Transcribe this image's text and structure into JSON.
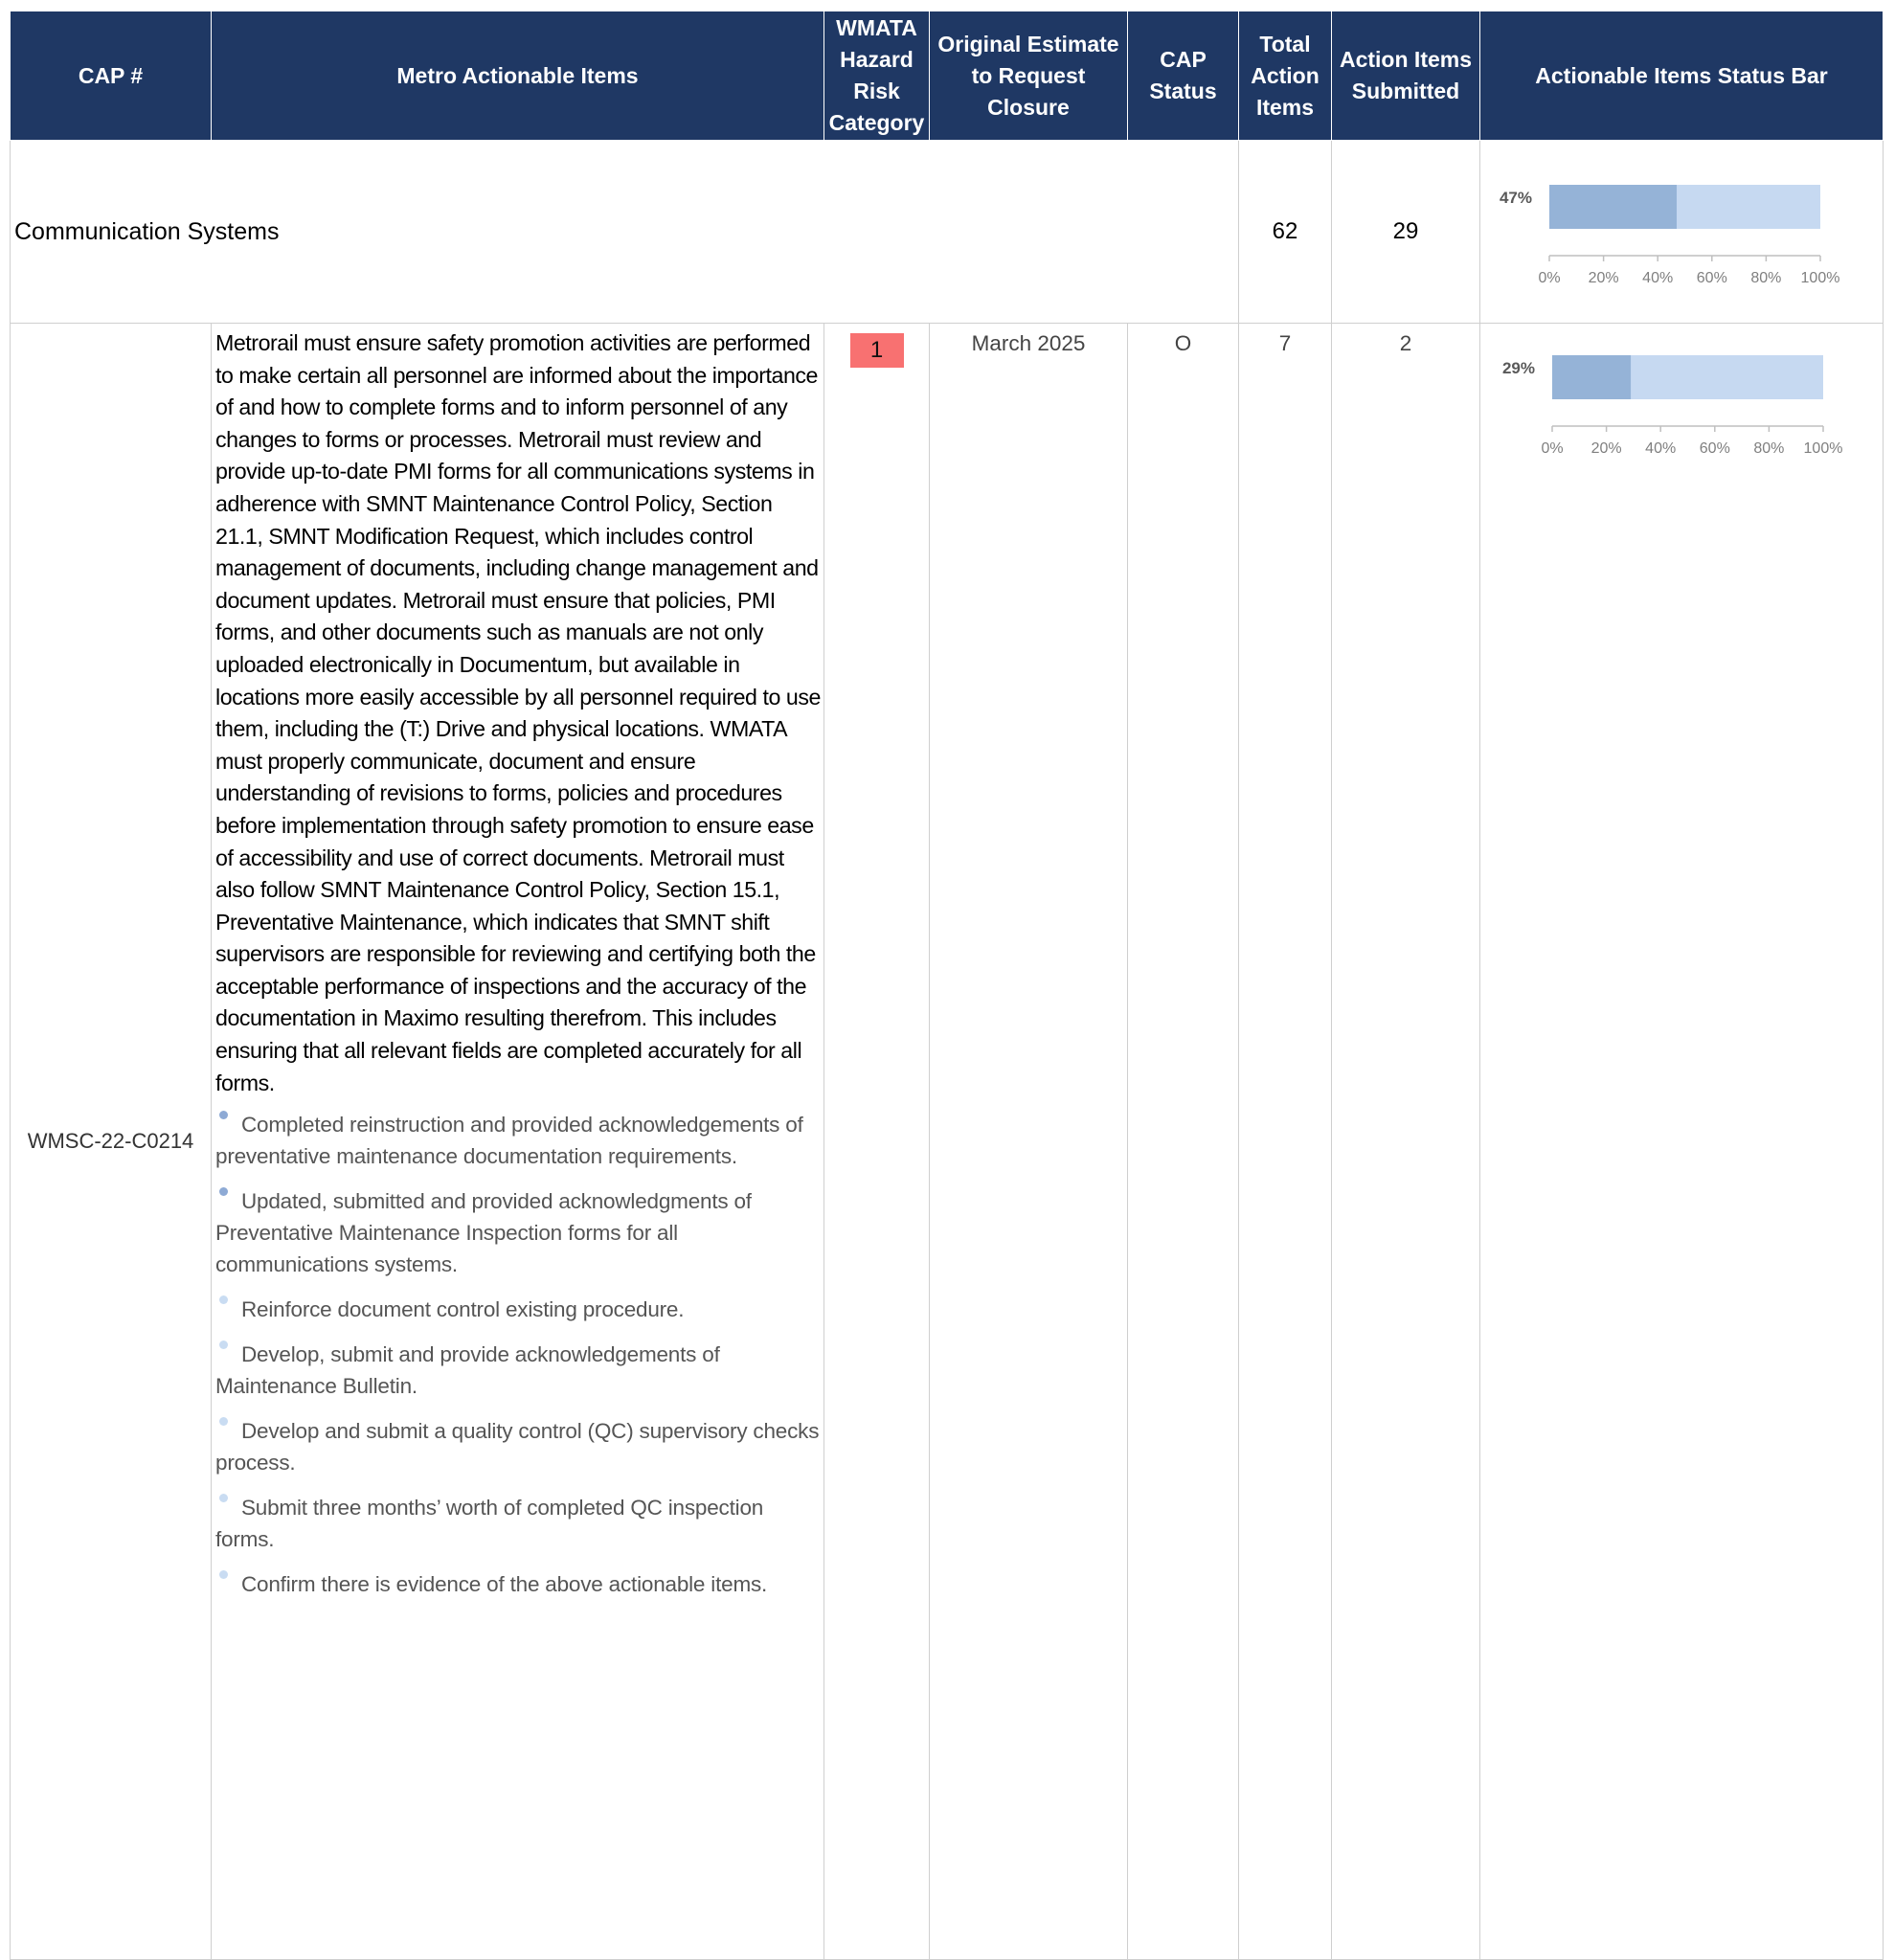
{
  "header": {
    "cap_num": "CAP #",
    "items": "Metro Actionable Items",
    "risk": "WMATA Hazard Risk Category",
    "estimate": "Original Estimate to Request Closure",
    "status": "CAP Status",
    "total": "Total Action Items",
    "submitted": "Action Items Submitted",
    "bar": "Actionable Items Status Bar"
  },
  "group": {
    "label": "Communication Systems",
    "total": "62",
    "submitted": "29",
    "percent_label": "47%",
    "percent": 0.47
  },
  "cap": {
    "id": "WMSC-22-C0214",
    "description": "Metrorail must ensure safety promotion activities are performed to make certain all personnel are informed about the importance of and how to complete forms and to inform personnel of any changes to forms or processes. Metrorail must review and provide up-to-date PMI forms for all communications systems in adherence with SMNT Maintenance Control Policy, Section 21.1, SMNT Modification Request, which includes control management of documents, including change management and document updates. Metrorail must ensure that policies, PMI forms, and other documents such as manuals are not only uploaded electronically in Documentum, but available in locations more easily accessible by all personnel required to use them, including the (T:) Drive and physical locations. WMATA must properly communicate, document and ensure understanding of revisions to forms, policies and procedures before implementation through safety promotion to ensure ease of accessibility and use of correct documents. Metrorail must also follow SMNT Maintenance Control Policy, Section 15.1, Preventative Maintenance, which indicates that SMNT shift supervisors are responsible for reviewing and certifying both the acceptable performance of inspections and the accuracy of the documentation in Maximo resulting therefrom. This includes ensuring that all relevant fields are completed accurately for all forms.",
    "action_items": [
      {
        "text": "Completed reinstruction and provided acknowledgements of preventative maintenance documentation requirements.",
        "status": "done"
      },
      {
        "text": "Updated, submitted and provided acknowledgments of Preventative Maintenance Inspection forms for all communications systems.",
        "status": "done"
      },
      {
        "text": "Reinforce document control existing procedure.",
        "status": "todo"
      },
      {
        "text": "Develop, submit and provide acknowledgements of Maintenance Bulletin.",
        "status": "todo"
      },
      {
        "text": "Develop and submit a quality control (QC) supervisory checks process.",
        "status": "todo"
      },
      {
        "text": "Submit three months’ worth of completed QC inspection forms.",
        "status": "todo"
      },
      {
        "text": "Confirm there is evidence of the above actionable items.",
        "status": "todo"
      }
    ],
    "risk": "1",
    "estimate": "March 2025",
    "status": "O",
    "total": "7",
    "submitted": "2",
    "percent_label": "29%",
    "percent": 0.29
  },
  "colors": {
    "header_bg": "#1f3864",
    "risk_bg": "#f87171",
    "bar_done": "#95b3d7",
    "bar_remaining": "#c6d9f1"
  },
  "chart_data": [
    {
      "type": "bar",
      "orientation": "horizontal",
      "categories": [
        "Communication Systems"
      ],
      "values": [
        47
      ],
      "data_label": "47%",
      "xlim": [
        0,
        100
      ],
      "xticks": [
        "0%",
        "20%",
        "40%",
        "60%",
        "80%",
        "100%"
      ]
    },
    {
      "type": "bar",
      "orientation": "horizontal",
      "categories": [
        "WMSC-22-C0214"
      ],
      "values": [
        29
      ],
      "data_label": "29%",
      "xlim": [
        0,
        100
      ],
      "xticks": [
        "0%",
        "20%",
        "40%",
        "60%",
        "80%",
        "100%"
      ]
    }
  ]
}
